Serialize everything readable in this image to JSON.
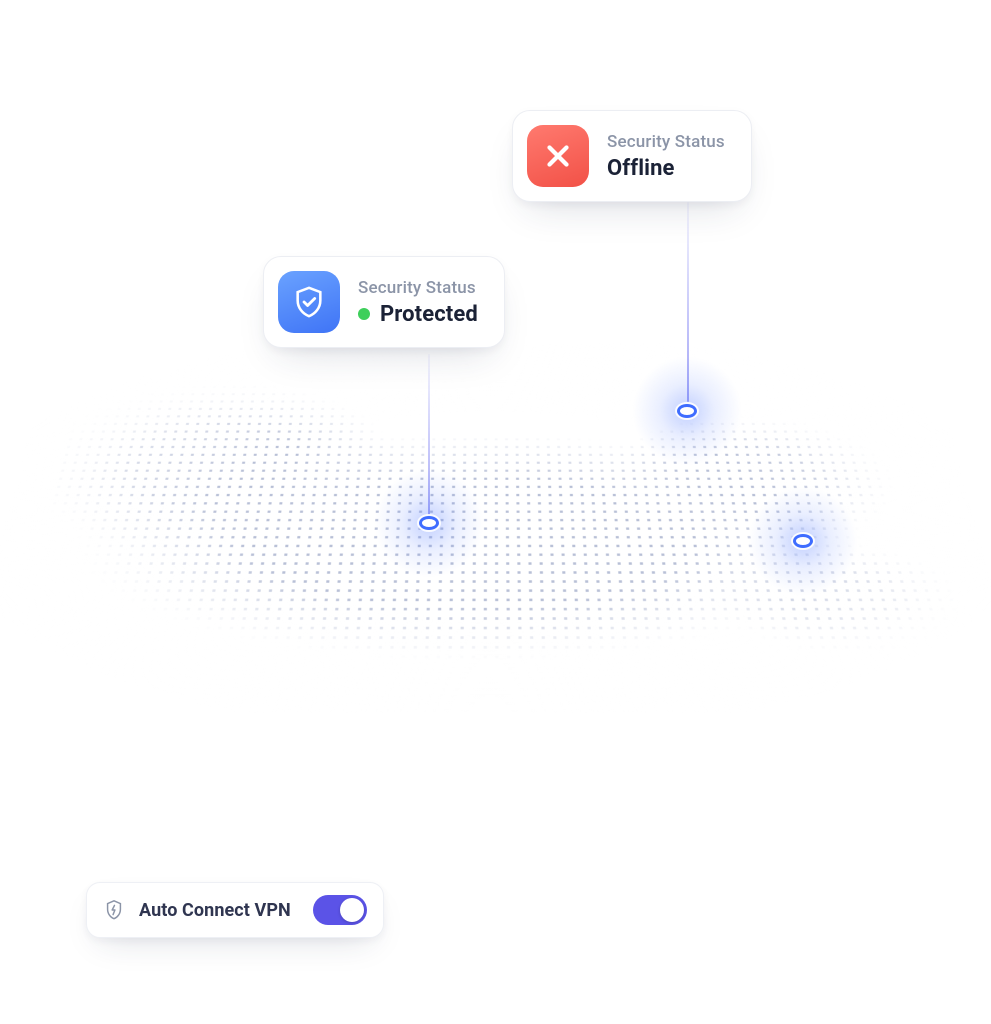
{
  "status_cards": {
    "offline": {
      "label": "Security Status",
      "value": "Offline",
      "icon": "x-icon",
      "badge_color": "#f25147"
    },
    "protected": {
      "label": "Security Status",
      "value": "Protected",
      "icon": "shield-check-icon",
      "badge_color": "#3f74f6",
      "indicator_color": "#3ecf5b"
    }
  },
  "auto_connect": {
    "label": "Auto Connect VPN",
    "icon": "shield-bolt-icon",
    "enabled": true
  },
  "colors": {
    "toggle_on": "#5b53e7",
    "map_dot": "#7d8bb5",
    "marker": "#3f6dff",
    "text_primary": "#1b2236",
    "text_secondary": "#8b94a7"
  }
}
